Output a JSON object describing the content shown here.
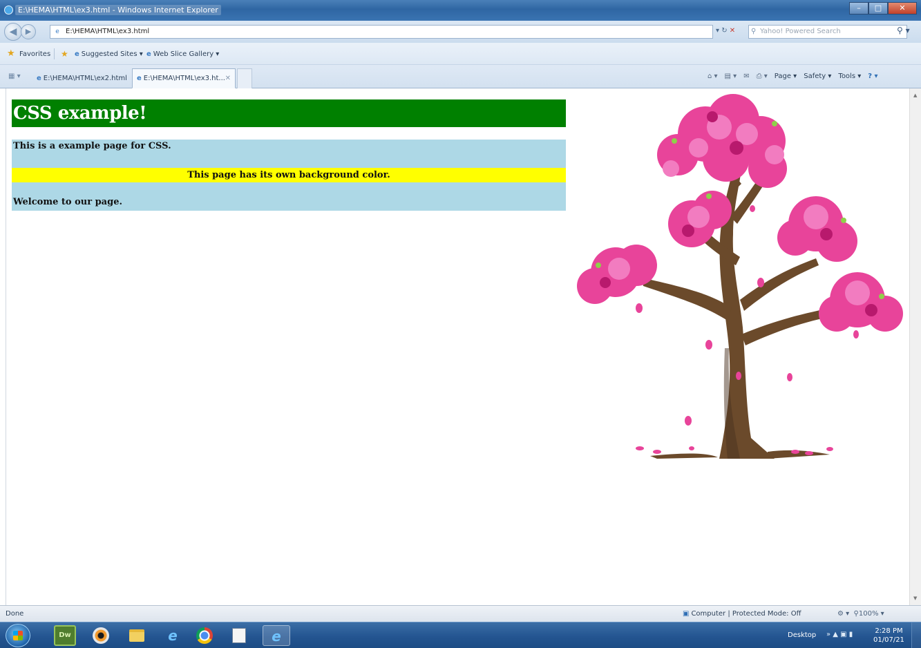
{
  "window": {
    "title": "E:\\HEMA\\HTML\\ex3.html - Windows Internet Explorer",
    "caption_buttons": [
      "minimize",
      "maximize",
      "close"
    ]
  },
  "address_bar": {
    "url": "E:\\HEMA\\HTML\\ex3.html",
    "refresh_icon": "refresh-icon",
    "stop_icon": "stop-icon",
    "search_placeholder": "Yahoo! Powered Search"
  },
  "favorites_bar": {
    "favorites_label": "Favorites",
    "suggested_sites": "Suggested Sites ▾",
    "web_slice_gallery": "Web Slice Gallery ▾"
  },
  "tabs": [
    {
      "label": "E:\\HEMA\\HTML\\ex2.html",
      "active": false
    },
    {
      "label": "E:\\HEMA\\HTML\\ex3.ht...",
      "active": true
    }
  ],
  "command_bar": {
    "page": "Page ▾",
    "safety": "Safety ▾",
    "tools": "Tools ▾"
  },
  "page": {
    "heading": "CSS example!",
    "p1": "This is a example page for CSS.",
    "p2": "This page has its own background color.",
    "p3": "Welcome to our page.",
    "colors": {
      "heading_bg": "#008000",
      "section_bg": "#add8e6",
      "highlight_bg": "#ffff00",
      "blossom": "#e8449a",
      "trunk": "#6b4a2b"
    },
    "image": "cherry-blossom-tree"
  },
  "status_bar": {
    "left": "Done",
    "zone": "Computer | Protected Mode: Off",
    "zoom": "100%"
  },
  "taskbar": {
    "apps": [
      "dreamweaver-icon",
      "media-player-icon",
      "folder-icon",
      "internet-explorer-icon",
      "chrome-icon",
      "document-icon",
      "internet-explorer-icon"
    ],
    "desktop_label": "Desktop",
    "time": "2:28 PM",
    "date": "01/07/21"
  }
}
